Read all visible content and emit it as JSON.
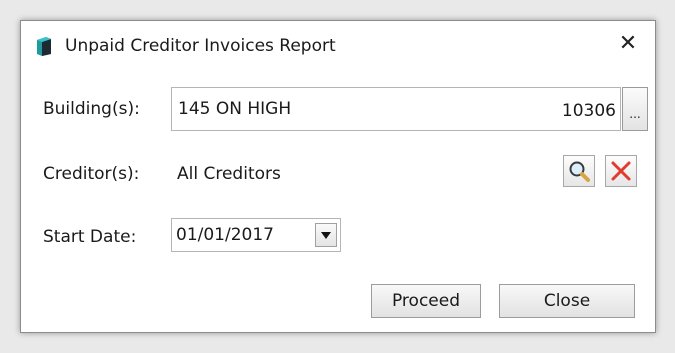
{
  "dialog": {
    "title": "Unpaid Creditor Invoices Report",
    "close_glyph": "✕",
    "app_icon": "report-database-icon"
  },
  "building": {
    "label": "Building(s):",
    "name": "145 ON HIGH",
    "code": "10306",
    "browse_label": "..."
  },
  "creditor": {
    "label": "Creditor(s):",
    "value": "All Creditors",
    "search_icon": "magnifier-icon",
    "clear_icon": "red-x-icon"
  },
  "start_date": {
    "label": "Start Date:",
    "value": "01/01/2017"
  },
  "actions": {
    "proceed_label": "Proceed",
    "close_label": "Close"
  },
  "colors": {
    "icon_teal": "#1f9aa0",
    "icon_dark": "#1c2b33",
    "clear_red": "#e23b2e",
    "search_gold": "#d9a441"
  }
}
